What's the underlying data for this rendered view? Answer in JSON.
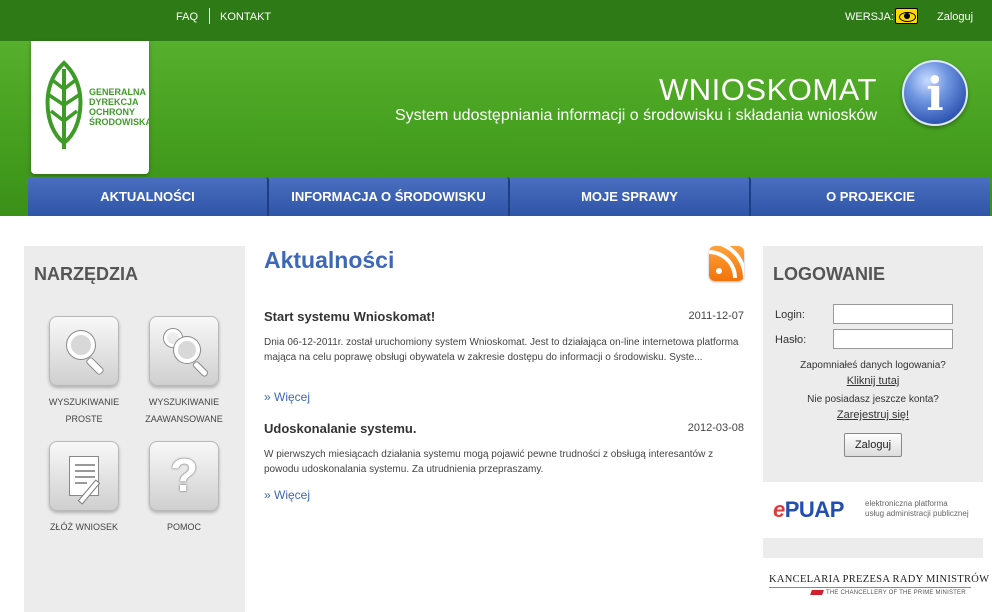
{
  "topbar": {
    "faq": "FAQ",
    "contact": "KONTAKT",
    "version_label": "WERSJA:",
    "version_icon": "eye-icon",
    "login_link": "Zaloguj"
  },
  "logo": {
    "lines": [
      "GENERALNA",
      "DYREKCJA",
      "OCHRONY",
      "ŚRODOWISKA"
    ]
  },
  "header": {
    "title": "WNIOSKOMAT",
    "subtitle": "System udostępniania informacji o środowisku i składania wniosków",
    "info_icon_glyph": "i"
  },
  "nav": {
    "tabs": [
      {
        "label": "AKTUALNOŚCI"
      },
      {
        "label": "INFORMACJA O ŚRODOWISKU"
      },
      {
        "label": "MOJE SPRAWY"
      },
      {
        "label": "O PROJEKCIE"
      }
    ]
  },
  "tools": {
    "title": "NARZĘDZIA",
    "items": [
      {
        "line1": "WYSZUKIWANIE",
        "line2": "PROSTE",
        "icon": "magnifier-icon"
      },
      {
        "line1": "WYSZUKIWANIE",
        "line2": "ZAAWANSOWANE",
        "icon": "advanced-search-icon"
      },
      {
        "line1": "ZŁÓŻ WNIOSEK",
        "line2": "",
        "icon": "document-pen-icon"
      },
      {
        "line1": "POMOC",
        "line2": "",
        "icon": "question-icon"
      }
    ],
    "help_glyph": "?"
  },
  "main": {
    "title": "Aktualności",
    "rss_icon": "rss-icon",
    "news": [
      {
        "title": "Start systemu Wnioskomat!",
        "date": "2011-12-07",
        "body": "Dnia 06-12-2011r. został uruchomiony system Wnioskomat. Jest to działająca on-line internetowa platforma mająca na celu poprawę obsługi obywatela w zakresie dostępu do informacji o środowisku. Syste...",
        "more": "» Więcej"
      },
      {
        "title": "Udoskonalanie systemu.",
        "date": "2012-03-08",
        "body": "W pierwszych miesiącach działania systemu mogą pojawić pewne trudności z obsługą interesantów z powodu udoskonalania systemu. Za utrudnienia przepraszamy.",
        "more": "» Więcej"
      }
    ]
  },
  "login": {
    "title": "LOGOWANIE",
    "login_label": "Login:",
    "password_label": "Hasło:",
    "login_value": "",
    "password_value": "",
    "forgot_text": "Zapomniałeś danych logowania?",
    "forgot_link": "Kliknij tutaj",
    "no_account_text": "Nie posiadasz jeszcze konta?",
    "register_link": "Zarejestruj się!",
    "submit": "Zaloguj"
  },
  "partners": {
    "epuap_e": "e",
    "epuap_rest": "PUAP",
    "epuap_desc": [
      "elektroniczna platforma",
      "usług administracji publicznej"
    ],
    "kprm": "KANCELARIA PREZESA RADY MINISTRÓW",
    "kprm_sub": "THE CHANCELLERY OF THE PRIME MINISTER"
  },
  "colors": {
    "topbar": "#2e7a16",
    "header_green": "#4aa223",
    "nav_blue": "#3a60b3",
    "title_blue": "#3d68b8",
    "panel_gray": "#ececec",
    "rss_orange": "#f58a1f"
  }
}
